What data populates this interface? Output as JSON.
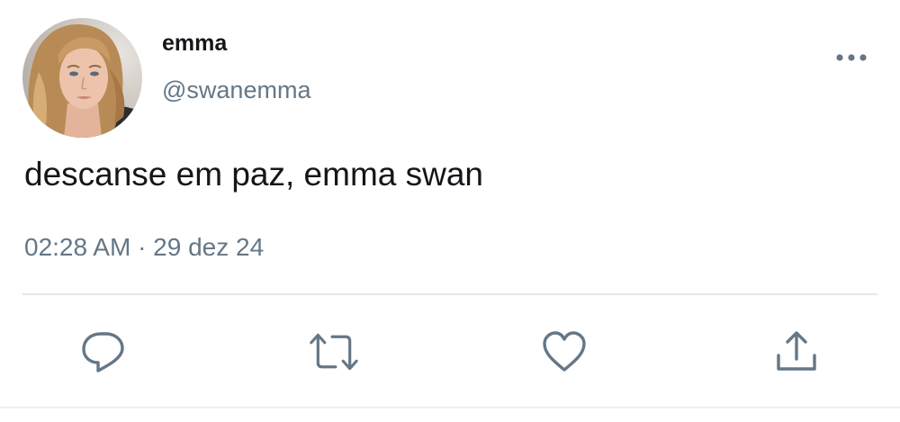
{
  "author": {
    "display_name": "emma",
    "handle": "@swanemma"
  },
  "tweet": {
    "text": "descanse em paz, emma swan",
    "timestamp": "02:28 AM · 29 dez 24"
  },
  "icons": {
    "more": "more-options-icon",
    "reply": "reply-icon",
    "retweet": "retweet-icon",
    "like": "heart-icon",
    "share": "share-icon"
  },
  "colors": {
    "text": "#14171a",
    "secondary": "#657786",
    "divider": "#e1e8ed"
  }
}
